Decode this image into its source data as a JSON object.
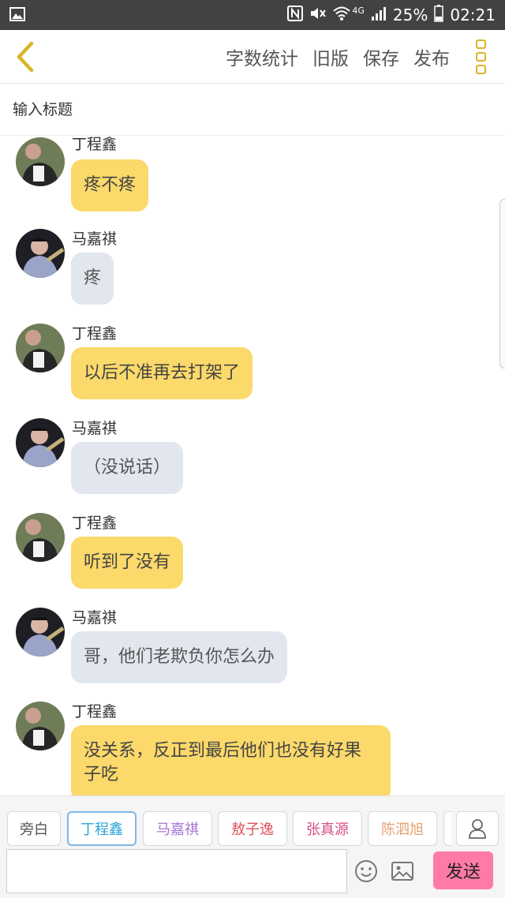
{
  "status_bar": {
    "battery": "25%",
    "time": "02:21",
    "network": "4G",
    "icons": [
      "gallery-icon",
      "nfc-icon",
      "mute-icon",
      "wifi-icon",
      "signal-icon",
      "battery-icon"
    ]
  },
  "header": {
    "back_icon": "chevron-left-icon",
    "actions": [
      "字数统计",
      "旧版",
      "保存",
      "发布"
    ],
    "more_icon": "more-vertical-icon",
    "accent_color": "#d9b526"
  },
  "title": {
    "placeholder": "输入标题"
  },
  "messages": [
    {
      "speaker": "丁程鑫",
      "text": "疼不疼"
    },
    {
      "speaker": "马嘉祺",
      "text": "疼"
    },
    {
      "speaker": "丁程鑫",
      "text": "以后不准再去打架了"
    },
    {
      "speaker": "马嘉祺",
      "text": "（没说话）"
    },
    {
      "speaker": "丁程鑫",
      "text": "听到了没有"
    },
    {
      "speaker": "马嘉祺",
      "text": "哥，他们老欺负你怎么办"
    },
    {
      "speaker": "丁程鑫",
      "text": "没关系，反正到最后他们也没有好果子吃"
    }
  ],
  "characters": [
    {
      "label": "旁白",
      "color": "#555555"
    },
    {
      "label": "丁程鑫",
      "color": "#2aa6d6",
      "selected": true
    },
    {
      "label": "马嘉祺",
      "color": "#a874d8"
    },
    {
      "label": "敖子逸",
      "color": "#e0525a"
    },
    {
      "label": "张真源",
      "color": "#d64f8a"
    },
    {
      "label": "陈泗旭",
      "color": "#e8a070"
    }
  ],
  "input": {
    "placeholder": "",
    "send_label": "发送",
    "send_color": "#ff7aa8"
  },
  "colors": {
    "ding_bubble": "#fbd96a",
    "ma_bubble": "#e2e7ef"
  }
}
